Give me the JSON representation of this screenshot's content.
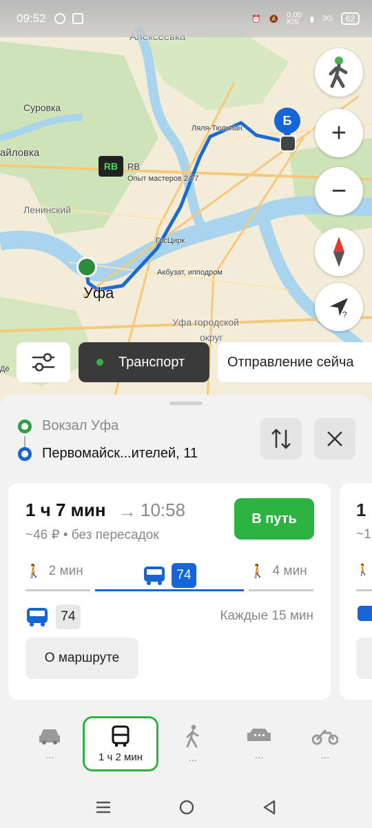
{
  "status_bar": {
    "time": "09:52",
    "net_speed": "0,00\nK/S",
    "signal": "3G",
    "battery": "62"
  },
  "map": {
    "labels": {
      "alekseevka": "Алексеевка",
      "surovka": "Суровка",
      "aylovka": "айловка",
      "leninsky": "Ленинский",
      "lyalya": "Ляля-Тюльпан",
      "rb_title": "RB",
      "rb_sub": "Опыт мастеров 24/7",
      "goscirk": "ГосЦирк",
      "akbuzat": "Акбузат, ипподром",
      "ufa": "Уфа",
      "ufa_district_1": "Уфа городской",
      "ufa_district_2": "округ",
      "de": "Дё"
    },
    "marker_b_letter": "Б"
  },
  "chips": {
    "transport": "Транспорт",
    "depart": "Отправление сейча"
  },
  "route": {
    "from": "Вокзал Уфа",
    "to": "Первомайск...ителей, 11"
  },
  "card": {
    "duration": "1 ч 7 мин",
    "arrow": "→",
    "arrival": "10:58",
    "meta": "~46 ₽ • без пересадок",
    "go": "В путь",
    "walk1": "2 мин",
    "bus_number": "74",
    "walk2": "4 мин",
    "bus_number_2": "74",
    "every": "Каждые 15 мин",
    "about": "О маршруте"
  },
  "card2": {
    "duration_fragment": "1",
    "meta_fragment": "~1"
  },
  "modes": {
    "car": "...",
    "transit": "1 ч 2 мин",
    "walk": "...",
    "taxi": "...",
    "moto": "..."
  },
  "colors": {
    "accent_green": "#2db342",
    "route_blue": "#1565d8"
  }
}
